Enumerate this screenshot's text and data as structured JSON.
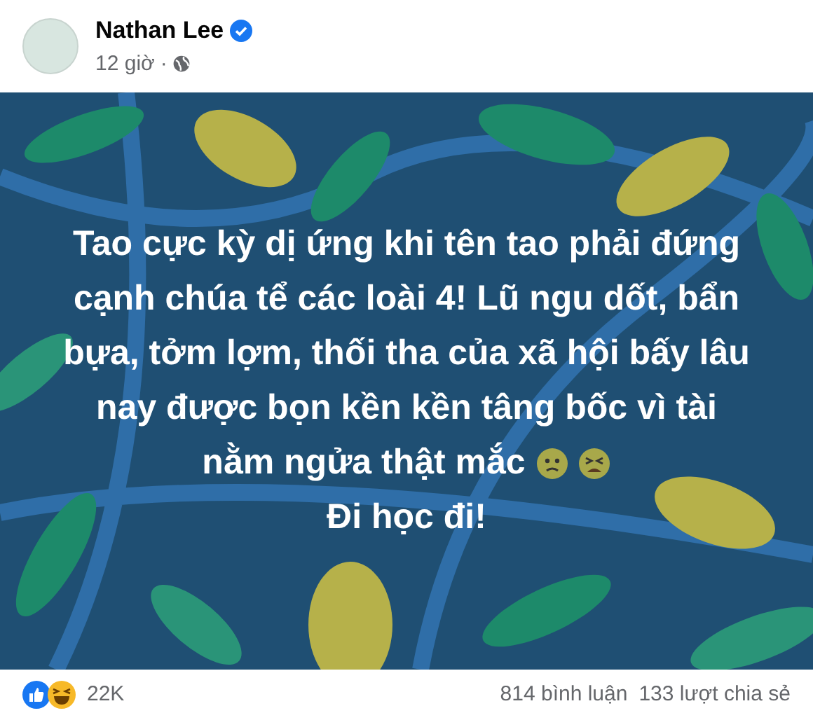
{
  "post": {
    "author": "Nathan Lee",
    "verified": true,
    "time": "12 giờ",
    "separator": "·",
    "text": "Tao cực kỳ dị ứng khi tên tao phải đứng cạnh chúa tể các loài 4! Lũ ngu dốt, bẩn bựa, tởm lợm, thối tha của xã hội bấy lâu nay được bọn kền kền tâng bốc vì tài",
    "text_end": "nằm ngửa thật mắc",
    "closing": "Đi học đi!"
  },
  "footer": {
    "reactions": "22K",
    "comments": "814 bình luận",
    "shares": "133 lượt chia sẻ"
  }
}
